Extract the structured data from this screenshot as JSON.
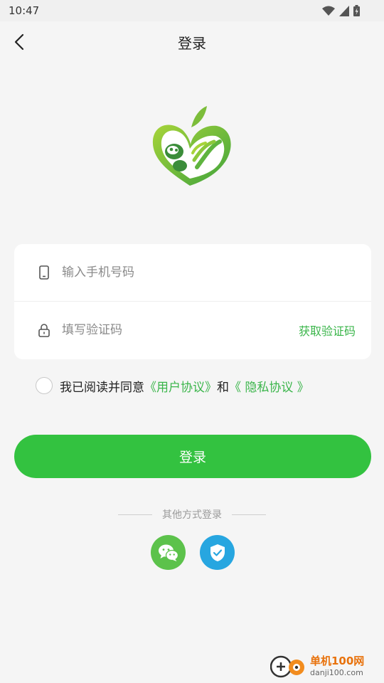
{
  "status_bar": {
    "time": "10:47"
  },
  "header": {
    "title": "登录"
  },
  "form": {
    "phone_placeholder": "输入手机号码",
    "code_placeholder": "填写验证码",
    "get_code_label": "获取验证码"
  },
  "agreement": {
    "prefix": "我已阅读并同意",
    "user_agreement": "《用户协议》",
    "conjunction": "和",
    "privacy_policy": "《 隐私协议 》"
  },
  "login_button": "登录",
  "other_login": {
    "label": "其他方式登录",
    "methods": [
      "wechat-icon",
      "shield-check-icon"
    ]
  },
  "watermark": {
    "name": "单机100网",
    "url": "danji100.com"
  },
  "colors": {
    "accent": "#33c240",
    "link": "#3ab54a",
    "wechat": "#5cc24b",
    "shield": "#27a6e0"
  }
}
